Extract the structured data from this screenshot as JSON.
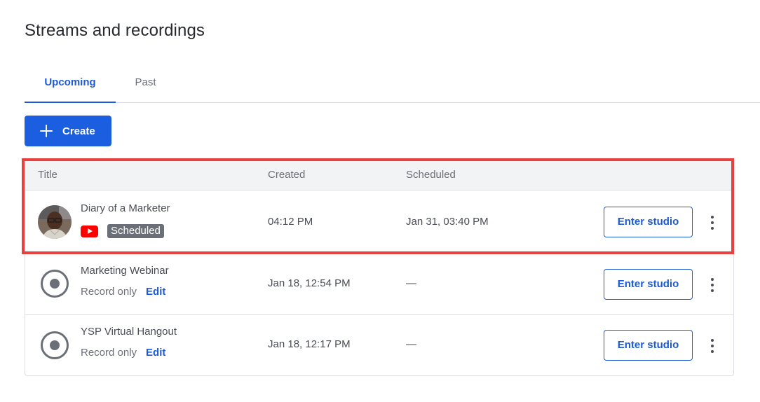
{
  "page": {
    "title": "Streams and recordings"
  },
  "tabs": [
    {
      "label": "Upcoming",
      "active": true
    },
    {
      "label": "Past",
      "active": false
    }
  ],
  "create_button": {
    "label": "Create",
    "icon": "plus-icon",
    "color": "#1b5fe0"
  },
  "table": {
    "columns": [
      "Title",
      "Created",
      "Scheduled"
    ],
    "rows": [
      {
        "title": "Diary of a Marketer",
        "platform_icon": "youtube-icon",
        "status": "Scheduled",
        "created": "04:12 PM",
        "scheduled": "Jan 31, 03:40 PM",
        "action": "Enter studio"
      },
      {
        "title": "Marketing Webinar",
        "icon": "record-icon",
        "type": "Record only",
        "edit": "Edit",
        "created": "Jan 18, 12:54 PM",
        "scheduled": "—",
        "action": "Enter studio"
      },
      {
        "title": "YSP Virtual Hangout",
        "icon": "record-icon",
        "type": "Record only",
        "edit": "Edit",
        "created": "Jan 18, 12:17 PM",
        "scheduled": "—",
        "action": "Enter studio"
      }
    ]
  },
  "colors": {
    "accent": "#1c5ad6",
    "highlight": "#e8413f",
    "youtube": "#ff0000"
  }
}
